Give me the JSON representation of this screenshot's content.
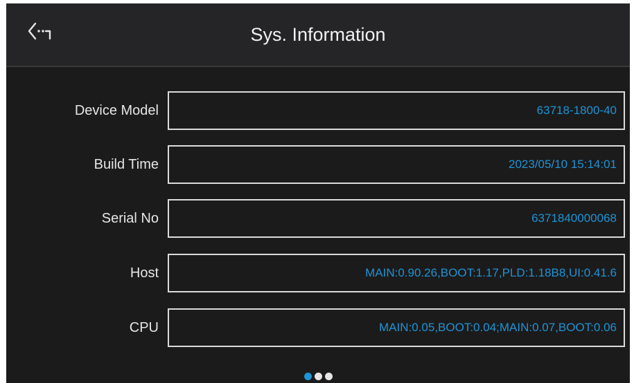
{
  "header": {
    "title": "Sys. Information",
    "back_icon": "back-arrow-icon"
  },
  "rows": [
    {
      "label": "Device Model",
      "value": "63718-1800-40"
    },
    {
      "label": "Build Time",
      "value": "2023/05/10 15:14:01"
    },
    {
      "label": "Serial No",
      "value": "6371840000068"
    },
    {
      "label": "Host",
      "value": "MAIN:0.90.26,BOOT:1.17,PLD:1.18B8,UI:0.41.6"
    },
    {
      "label": "CPU",
      "value": "MAIN:0.05,BOOT:0.04;MAIN:0.07,BOOT:0.06"
    }
  ],
  "pager": {
    "pages": 3,
    "current": 1
  },
  "colors": {
    "accent": "#1f93d6",
    "background": "#1b1b1b",
    "header": "#252426",
    "text": "#e6e6e6"
  }
}
